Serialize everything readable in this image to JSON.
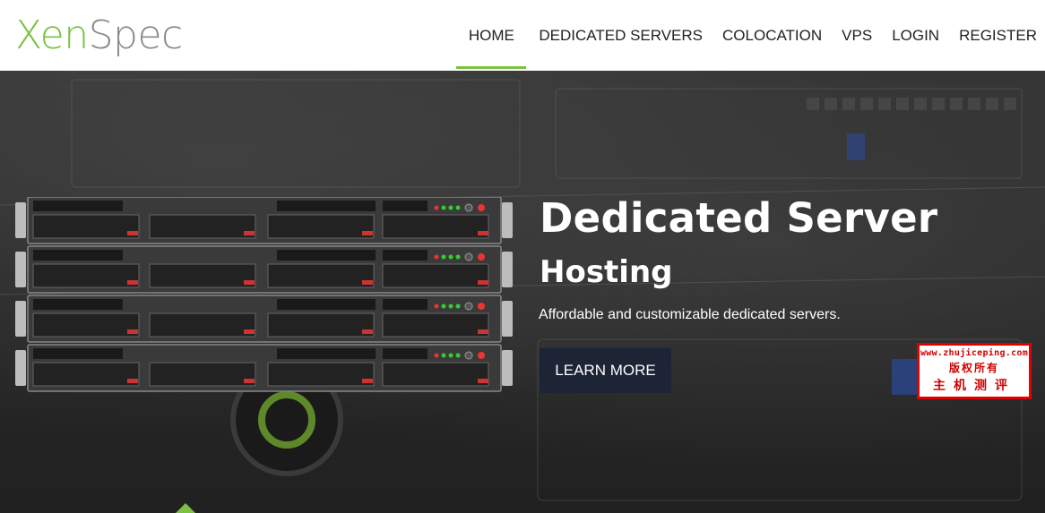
{
  "brand": {
    "logo_part1": "Xen",
    "logo_part2": "Spec",
    "accent": "#7bc142"
  },
  "nav": {
    "items": [
      {
        "label": "HOME",
        "active": true
      },
      {
        "label": "DEDICATED SERVERS"
      },
      {
        "label": "COLOCATION"
      },
      {
        "label": "VPS"
      },
      {
        "label": "LOGIN"
      },
      {
        "label": "REGISTER"
      }
    ]
  },
  "hero": {
    "title": "Dedicated Server",
    "subtitle": "Hosting",
    "description": "Affordable and customizable dedicated servers.",
    "cta_label": "LEARN MORE",
    "cta_color": "#1d2436",
    "image_icon": "server-rack-illustration"
  },
  "watermark": {
    "url": "www.zhujiceping.com",
    "line2": "版权所有",
    "line3": "主机测评"
  }
}
